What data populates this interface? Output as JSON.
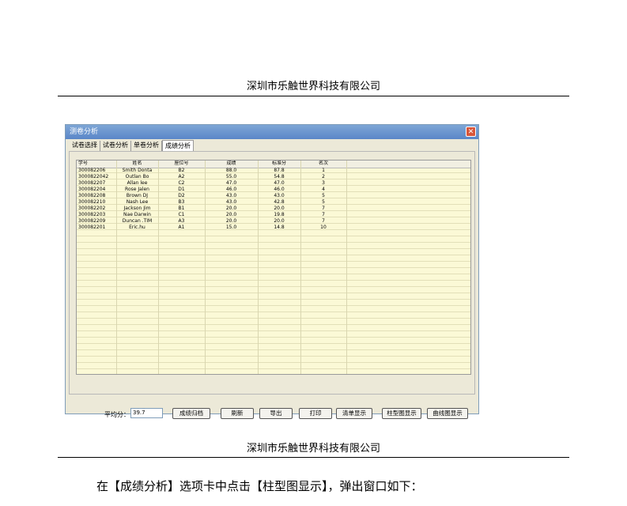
{
  "page_header": "深圳市乐触世界科技有限公司",
  "page_footer_header": "深圳市乐触世界科技有限公司",
  "instruction": "在【成绩分析】选项卡中点击【柱型图显示】，弹出窗口如下：",
  "window": {
    "title": "测卷分析",
    "close_glyph": "✕",
    "tabs": [
      "试卷选择",
      "试卷分析",
      "单卷分析",
      "成绩分析"
    ],
    "active_tab": "成绩分析",
    "columns": [
      "学号",
      "姓名",
      "座位号",
      "成绩",
      "标准分",
      "名次"
    ],
    "rows": [
      [
        "300082206",
        "Smith Donta",
        "B2",
        "88.0",
        "87.8",
        "1"
      ],
      [
        "3000822042",
        "Outlan Bo",
        "A2",
        "55.0",
        "54.8",
        "2"
      ],
      [
        "300082207",
        "Allan lee",
        "C2",
        "47.0",
        "47.0",
        "3"
      ],
      [
        "300082204",
        "Rose Jalen",
        "D1",
        "46.0",
        "46.0",
        "4"
      ],
      [
        "300082208",
        "Brown DJ",
        "D2",
        "43.0",
        "43.0",
        "5"
      ],
      [
        "300082210",
        "Nash Lee",
        "B3",
        "43.0",
        "42.8",
        "5"
      ],
      [
        "300082202",
        "Jackson Jim",
        "B1",
        "20.0",
        "20.0",
        "7"
      ],
      [
        "300082203",
        "Nae Darwin",
        "C1",
        "20.0",
        "19.8",
        "7"
      ],
      [
        "300082209",
        "Duncan .TIM",
        "A3",
        "20.0",
        "20.0",
        "7"
      ],
      [
        "300082201",
        "Eric.hu",
        "A1",
        "15.0",
        "14.8",
        "10"
      ]
    ],
    "average_label": "平均分：",
    "average_value": "39.7",
    "buttons": {
      "archive": "成绩归档",
      "refresh": "刷新",
      "export": "导出",
      "print": "打印",
      "list_view": "清单显示",
      "bar_chart": "柱型图显示",
      "line_chart": "曲线图显示"
    }
  }
}
